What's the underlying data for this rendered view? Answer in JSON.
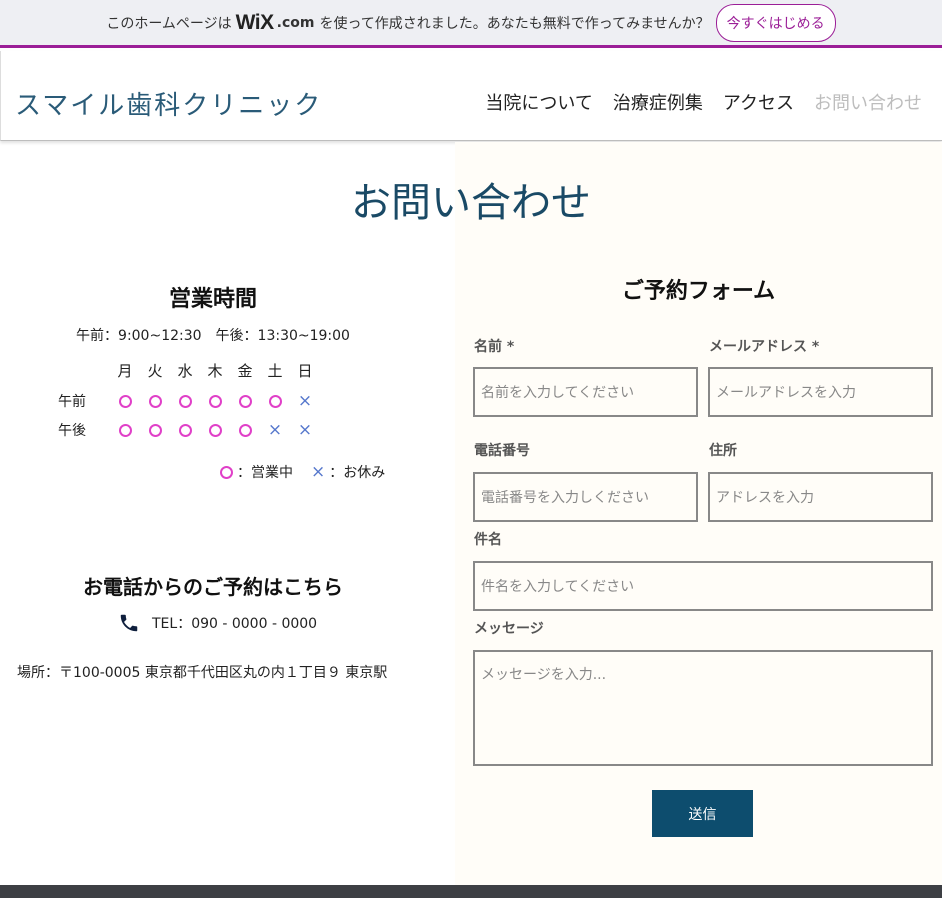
{
  "banner": {
    "pre_text": "このホームページは",
    "logo": "WiX",
    "logo_suffix": ".com",
    "post_text": "を使って作成されました。あなたも無料で作ってみませんか？",
    "cta": "今すぐはじめる"
  },
  "header": {
    "site_title": "スマイル歯科クリニック",
    "nav": [
      {
        "label": "当院について"
      },
      {
        "label": "治療症例集"
      },
      {
        "label": "アクセス"
      },
      {
        "label": "お問い合わせ"
      }
    ]
  },
  "page_title": "お問い合わせ",
  "hours": {
    "title": "営業時間",
    "text": "午前：9:00~12:30　午後：13:30~19:00",
    "days": [
      "月",
      "火",
      "水",
      "木",
      "金",
      "土",
      "日"
    ],
    "rows": [
      {
        "label": "午前",
        "marks": [
          "open",
          "open",
          "open",
          "open",
          "open",
          "open",
          "closed"
        ]
      },
      {
        "label": "午後",
        "marks": [
          "open",
          "open",
          "open",
          "open",
          "open",
          "closed",
          "closed"
        ]
      }
    ],
    "legend_open": "：営業中",
    "legend_closed": "：お休み",
    "closed_symbol": "×"
  },
  "phone": {
    "title": "お電話からのご予約はこちら",
    "tel": "TEL：090 - 0000 - 0000",
    "address": "場所：〒100-0005 東京都千代田区丸の内１丁目９ 東京駅"
  },
  "form": {
    "title": "ご予約フォーム",
    "name_label": "名前 *",
    "name_placeholder": "名前を入力してください",
    "email_label": "メールアドレス *",
    "email_placeholder": "メールアドレスを入力",
    "phone_label": "電話番号",
    "phone_placeholder": "電話番号を入力しください",
    "address_label": "住所",
    "address_placeholder": "アドレスを入力",
    "subject_label": "件名",
    "subject_placeholder": "件名を入力してください",
    "message_label": "メッセージ",
    "message_placeholder": "メッセージを入力...",
    "submit": "送信"
  },
  "colors": {
    "accent": "#9b1e97",
    "brand": "#1a4a66",
    "button": "#0d4d6e",
    "open_mark": "#e040c8",
    "closed_mark": "#5577cc"
  }
}
